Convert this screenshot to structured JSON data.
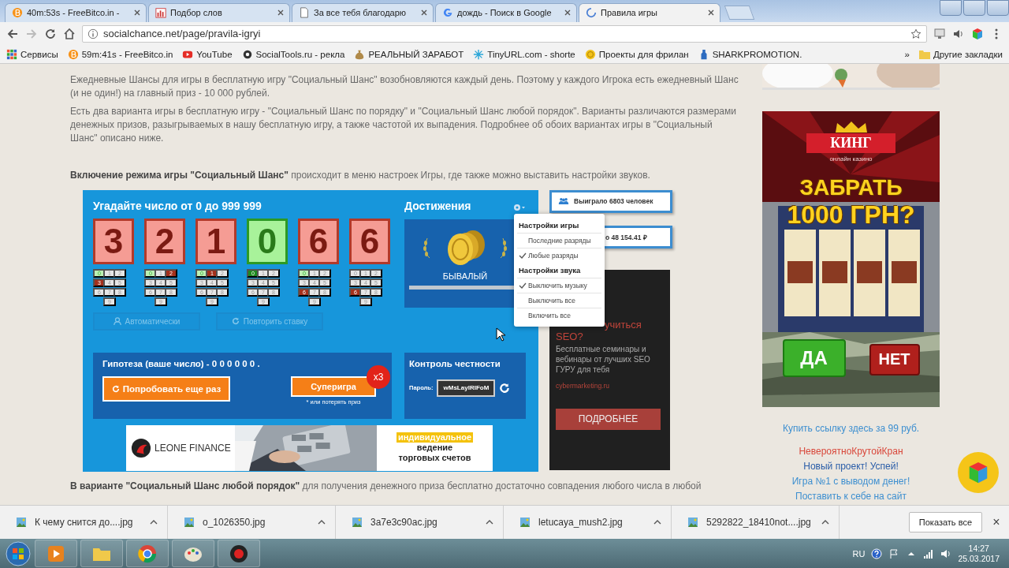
{
  "browser": {
    "tabs": [
      {
        "title": "40m:53s - FreeBitco.in -",
        "selected": false
      },
      {
        "title": "Подбор слов",
        "selected": false
      },
      {
        "title": "За все тебя благодарю",
        "selected": false
      },
      {
        "title": "дождь - Поиск в Google",
        "selected": false
      },
      {
        "title": "Правила игры",
        "selected": true
      }
    ],
    "address": "socialchance.net/page/pravila-igryi",
    "bookmarks": [
      "Сервисы",
      "59m:41s - FreeBitco.in",
      "YouTube",
      "SocialTools.ru - рекла",
      "РЕАЛЬНЫЙ ЗАРАБОТ",
      "TinyURL.com - shorte",
      "Проекты для фрилан",
      "SHARKPROMOTION."
    ],
    "more": "»",
    "other_bookmarks": "Другие закладки"
  },
  "article": {
    "paragraphs": [
      "Ежедневные Шансы для игры в бесплатную игру \"Социальный Шанс\" возобновляются каждый день. Поэтому у каждого Игрока есть ежедневный Шанс (и не один!) на главный приз - 10 000 рублей.",
      "Есть два варианта игры в бесплатную игру - \"Социальный Шанс по порядку\" и \"Социальный Шанс любой порядок\". Варианты различаются размерами денежных призов, разыгрываемых в нашу бесплатную игру, а также частотой их выпадения. Подробнее об обоих вариантах игры в \"Социальный Шанс\" описано ниже."
    ],
    "mode_note": "**Включение режима игры \"Социальный Шанс\"** происходит в меню настроек Игры, где также можно выставить настройки звуков.",
    "last_line": "**В варианте \"Социальный Шанс любой порядок\"** для получения денежного приза бесплатно достаточно совпадения любого числа в любой"
  },
  "game": {
    "title": "Угадайте число от 0 до 999 999",
    "digits": [
      {
        "value": "3",
        "matched": false,
        "keys": [
          {
            "label": "0",
            "hint": true,
            "picked": false
          },
          {
            "label": "1",
            "hint": false,
            "picked": false
          },
          {
            "label": "2",
            "hint": false,
            "picked": false
          },
          {
            "label": "3",
            "hint": false,
            "picked": true
          },
          {
            "label": "4",
            "hint": false,
            "picked": false
          },
          {
            "label": "5",
            "hint": false,
            "picked": false
          },
          {
            "label": "6",
            "hint": false,
            "picked": false
          },
          {
            "label": "7",
            "hint": false,
            "picked": false
          },
          {
            "label": "8",
            "hint": false,
            "picked": false
          },
          {
            "label": "9",
            "hint": false,
            "picked": false
          }
        ]
      },
      {
        "value": "2",
        "matched": false,
        "keys": [
          {
            "label": "0",
            "hint": true,
            "picked": false
          },
          {
            "label": "1",
            "hint": false,
            "picked": false
          },
          {
            "label": "2",
            "hint": false,
            "picked": true
          },
          {
            "label": "3",
            "hint": false,
            "picked": false
          },
          {
            "label": "4",
            "hint": false,
            "picked": false
          },
          {
            "label": "5",
            "hint": false,
            "picked": false
          },
          {
            "label": "6",
            "hint": false,
            "picked": false
          },
          {
            "label": "7",
            "hint": false,
            "picked": false
          },
          {
            "label": "8",
            "hint": false,
            "picked": false
          },
          {
            "label": "9",
            "hint": false,
            "picked": false
          }
        ]
      },
      {
        "value": "1",
        "matched": false,
        "keys": [
          {
            "label": "0",
            "hint": true,
            "picked": false
          },
          {
            "label": "1",
            "hint": false,
            "picked": true
          },
          {
            "label": "2",
            "hint": false,
            "picked": false
          },
          {
            "label": "3",
            "hint": false,
            "picked": false
          },
          {
            "label": "4",
            "hint": false,
            "picked": false
          },
          {
            "label": "5",
            "hint": false,
            "picked": false
          },
          {
            "label": "6",
            "hint": false,
            "picked": false
          },
          {
            "label": "7",
            "hint": false,
            "picked": false
          },
          {
            "label": "8",
            "hint": false,
            "picked": false
          },
          {
            "label": "9",
            "hint": false,
            "picked": false
          }
        ]
      },
      {
        "value": "0",
        "matched": true,
        "keys": [
          {
            "label": "0",
            "hint": false,
            "picked": true
          },
          {
            "label": "1",
            "hint": false,
            "picked": false
          },
          {
            "label": "2",
            "hint": false,
            "picked": false
          },
          {
            "label": "3",
            "hint": false,
            "picked": false
          },
          {
            "label": "4",
            "hint": false,
            "picked": false
          },
          {
            "label": "5",
            "hint": false,
            "picked": false
          },
          {
            "label": "6",
            "hint": false,
            "picked": false
          },
          {
            "label": "7",
            "hint": false,
            "picked": false
          },
          {
            "label": "8",
            "hint": false,
            "picked": false
          },
          {
            "label": "9",
            "hint": false,
            "picked": false
          }
        ]
      },
      {
        "value": "6",
        "matched": false,
        "keys": [
          {
            "label": "0",
            "hint": true,
            "picked": false
          },
          {
            "label": "1",
            "hint": false,
            "picked": false
          },
          {
            "label": "2",
            "hint": false,
            "picked": false
          },
          {
            "label": "3",
            "hint": false,
            "picked": false
          },
          {
            "label": "4",
            "hint": false,
            "picked": false
          },
          {
            "label": "5",
            "hint": false,
            "picked": false
          },
          {
            "label": "6",
            "hint": false,
            "picked": true
          },
          {
            "label": "7",
            "hint": false,
            "picked": false
          },
          {
            "label": "8",
            "hint": false,
            "picked": false
          },
          {
            "label": "9",
            "hint": false,
            "picked": false
          }
        ]
      },
      {
        "value": "6",
        "matched": false,
        "keys": [
          {
            "label": "0",
            "hint": false,
            "picked": false
          },
          {
            "label": "1",
            "hint": false,
            "picked": false
          },
          {
            "label": "2",
            "hint": false,
            "picked": false
          },
          {
            "label": "3",
            "hint": false,
            "picked": false
          },
          {
            "label": "4",
            "hint": false,
            "picked": false
          },
          {
            "label": "5",
            "hint": false,
            "picked": false
          },
          {
            "label": "6",
            "hint": false,
            "picked": true
          },
          {
            "label": "7",
            "hint": false,
            "picked": false
          },
          {
            "label": "8",
            "hint": false,
            "picked": false
          },
          {
            "label": "9",
            "hint": false,
            "picked": false
          }
        ]
      }
    ],
    "mode_buttons": [
      {
        "label": "Автоматически",
        "disabled": true
      },
      {
        "label": "Повторить ставку",
        "disabled": true
      }
    ],
    "hypothesis": "Гипотеза (ваше число) - 0 0 0 0 0 0 .",
    "retry_button": "Попробовать еще раз",
    "super_button": "Суперигра",
    "multiplier": "x3",
    "super_note": "* или потерять приз",
    "achievements": {
      "title": "Достижения",
      "rank": "БЫВАЛЫЙ",
      "level": 0.97
    },
    "honesty": {
      "title": "Контроль честности",
      "password_label": "Пароль:",
      "password": "wMsLaylRlFoM"
    },
    "banner": {
      "brand": "LEONE FINANCE",
      "highlight": "индивидуальное",
      "line_1": "ведение",
      "line_2": "торговых счетов"
    }
  },
  "settings_menu": {
    "sections": [
      {
        "title": "Настройки игры",
        "items": [
          {
            "label": "Последние разряды",
            "checked": false
          },
          {
            "label": "Любые разряды",
            "checked": true
          }
        ]
      },
      {
        "title": "Настройки звука",
        "items": [
          {
            "label": "Выключить музыку",
            "checked": true
          },
          {
            "label": "Выключить все",
            "checked": false
          },
          {
            "label": "Включить все",
            "checked": false
          }
        ]
      }
    ]
  },
  "stats": [
    "Выиграло 6803 человек",
    "о 48 154.41 ₽"
  ],
  "seo_ad": {
    "heading_1": "учиться",
    "heading_2": "SEO?",
    "body": "Бесплатные семинары и вебинары от лучших SEO ГУРУ для тебя",
    "site": "cybermarketing.ru",
    "button": "ПОДРОБНЕЕ"
  },
  "sidebar": {
    "casino_ad": {
      "brand": "КИНГ",
      "tagline": "онлайн казино",
      "headline_1": "ЗАБРАТЬ",
      "headline_2": "1000 ГРН?",
      "yes": "ДА",
      "no": "НЕТ"
    },
    "links": [
      {
        "text": "Купить ссылку здесь за 99 руб.",
        "color": "#3d8fd0"
      },
      {
        "text": "НевероятноКрутойКран",
        "color": "#d9483b"
      },
      {
        "text": "Новый проект! Успей!",
        "color": "#2a5da8"
      },
      {
        "text": "Игра №1 с выводом денег!",
        "color": "#3d8fd0"
      },
      {
        "text": "Поставить к себе на сайт",
        "color": "#3d8fd0"
      }
    ]
  },
  "downloads": {
    "items": [
      "К чему снится до....jpg",
      "o_1026350.jpg",
      "3a7e3c90ac.jpg",
      "letucaya_mush2.jpg",
      "5292822_18410not....jpg"
    ],
    "show_all": "Показать все",
    "close": "×"
  },
  "taskbar": {
    "language": "RU",
    "time": "14:27",
    "date": "25.03.2017"
  }
}
